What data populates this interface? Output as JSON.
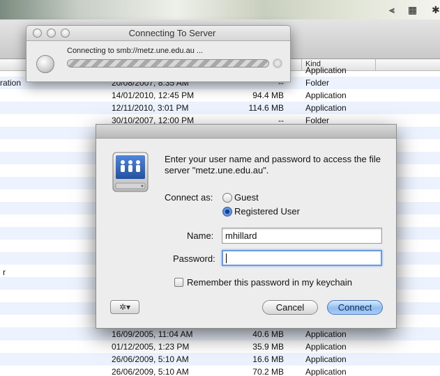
{
  "menubar": {
    "tray_icons": [
      "⫷",
      "▦",
      "✱"
    ]
  },
  "finder": {
    "column_kind": "Kind",
    "sidebar_fragment": "r",
    "rows_top": [
      {
        "name": "",
        "date": "",
        "size": "",
        "kind": "Application"
      },
      {
        "name": "ration",
        "date": "20/08/2007, 8:35 AM",
        "size": "--",
        "kind": "Folder"
      },
      {
        "name": "",
        "date": "14/01/2010, 12:45 PM",
        "size": "94.4 MB",
        "kind": "Application"
      },
      {
        "name": "",
        "date": "12/11/2010, 3:01 PM",
        "size": "114.6 MB",
        "kind": "Application"
      },
      {
        "name": "",
        "date": "30/10/2007, 12:00 PM",
        "size": "--",
        "kind": "Folder"
      }
    ],
    "rows_bottom": [
      {
        "date": "16/09/2005, 11:04 AM",
        "size": "40.6 MB",
        "kind": "Application"
      },
      {
        "date": "01/12/2005, 1:23 PM",
        "size": "35.9 MB",
        "kind": "Application"
      },
      {
        "date": "26/06/2009, 5:10 AM",
        "size": "16.6 MB",
        "kind": "Application"
      },
      {
        "date": "26/06/2009, 5:10 AM",
        "size": "70.2 MB",
        "kind": "Application"
      }
    ]
  },
  "connecting_window": {
    "title": "Connecting To Server",
    "message": "Connecting to smb://metz.une.edu.au ...",
    "stop_glyph": "⊗"
  },
  "login_dialog": {
    "prompt": "Enter your user name and password to access the file server \"metz.une.edu.au\".",
    "connect_as_label": "Connect as:",
    "guest_label": "Guest",
    "registered_label": "Registered User",
    "connect_as_selected": "Registered User",
    "name_label": "Name:",
    "name_value": "mhillard",
    "password_label": "Password:",
    "password_value": "",
    "remember_label": "Remember this password in my keychain",
    "remember_checked": false,
    "gear_glyph": "✲▾",
    "cancel_label": "Cancel",
    "connect_label": "Connect"
  },
  "colors": {
    "accent": "#6a9ae0",
    "row_alt": "#edf3fe",
    "server_icon": "#2f67c6"
  }
}
